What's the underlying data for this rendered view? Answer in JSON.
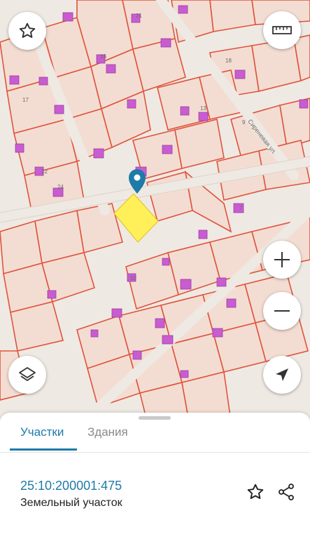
{
  "map": {
    "plot_numbers": [
      "21",
      "16",
      "17",
      "22",
      "24",
      "18",
      "13",
      "9",
      "7",
      "10"
    ],
    "street_name": "Сиреневая ул.",
    "colors": {
      "parcel_line": "#e0533d",
      "parcel_fill": "#f3ddd2",
      "building": "#c95cd1",
      "selected": "#fff05a",
      "pin": "#1e7aa8"
    }
  },
  "controls": {
    "favorite_icon": "star-outline-icon",
    "ruler_icon": "ruler-icon",
    "zoom_in_icon": "plus-icon",
    "zoom_out_icon": "minus-icon",
    "layers_icon": "layers-icon",
    "locate_icon": "navigation-arrow-icon"
  },
  "sheet": {
    "tabs": [
      {
        "label": "Участки",
        "active": true
      },
      {
        "label": "Здания",
        "active": false
      }
    ],
    "cadastral_number": "25:10:200001:475",
    "object_type": "Земельный участок",
    "favorite_icon": "star-outline-icon",
    "share_icon": "share-icon"
  }
}
